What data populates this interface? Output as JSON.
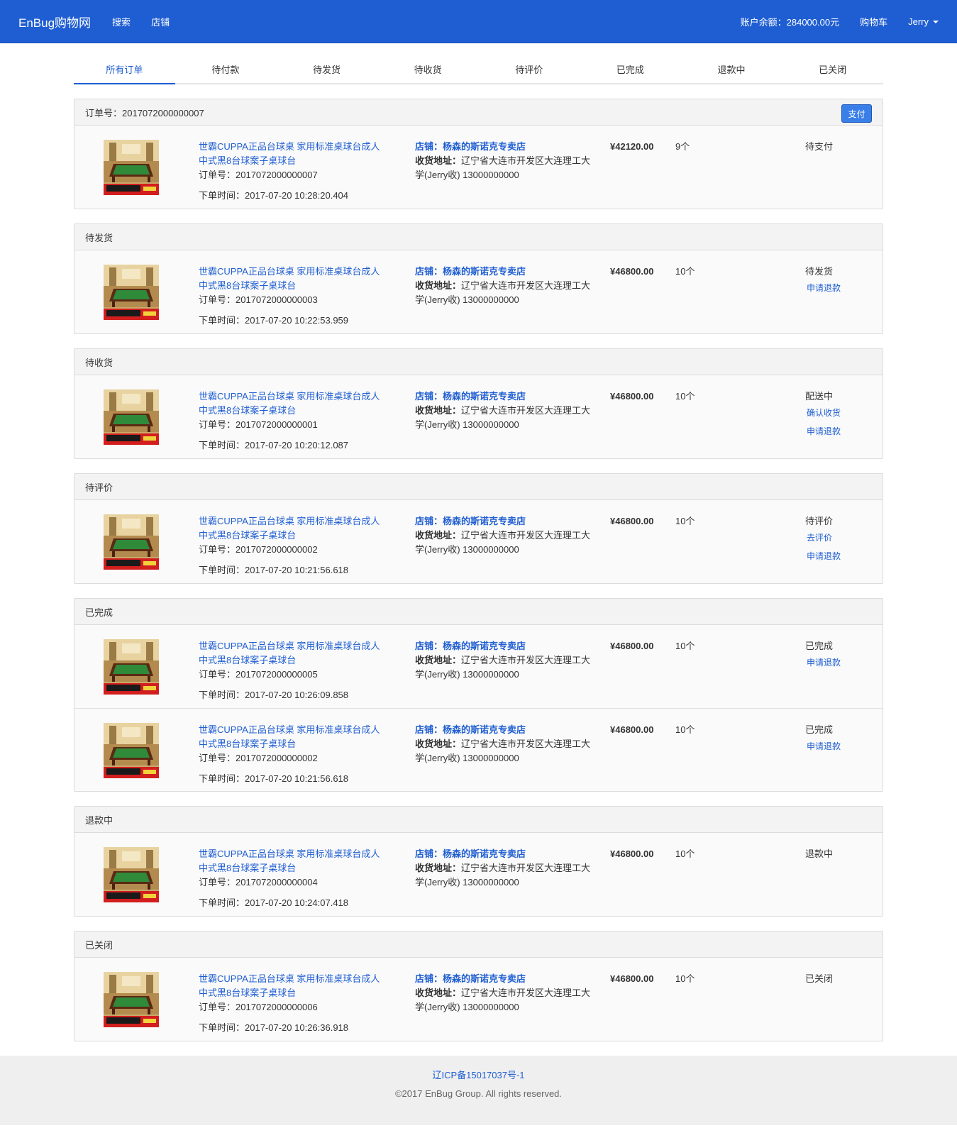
{
  "nav": {
    "brand": "EnBug购物网",
    "links": [
      "搜索",
      "店铺"
    ],
    "balance": "账户余额：284000.00元",
    "cart": "购物车",
    "user": "Jerry"
  },
  "tabs": [
    "所有订单",
    "待付款",
    "待发货",
    "待收货",
    "待评价",
    "已完成",
    "退款中",
    "已关闭"
  ],
  "pay_label": "支付",
  "panels": [
    {
      "header": "订单号：2017072000000007",
      "rows": [
        {
          "title1": "世霸CUPPA正品台球桌 家用标准桌球台成人",
          "title2": "中式黑8台球案子桌球台",
          "order_no": "订单号：2017072000000007",
          "time": "下单时间：2017-07-20 10:28:20.404",
          "shop": "店铺：杨森的斯诺克专卖店",
          "addr_label": "收货地址：",
          "addr1": "辽宁省大连市开发区大连理工大",
          "addr2": "学(Jerry收) 13000000000",
          "price": "¥42120.00",
          "qty": "9个",
          "status": "待支付",
          "actions": []
        }
      ]
    },
    {
      "header": "待发货",
      "rows": [
        {
          "title1": "世霸CUPPA正品台球桌 家用标准桌球台成人",
          "title2": "中式黑8台球案子桌球台",
          "order_no": "订单号：2017072000000003",
          "time": "下单时间：2017-07-20 10:22:53.959",
          "shop": "店铺：杨森的斯诺克专卖店",
          "addr_label": "收货地址：",
          "addr1": "辽宁省大连市开发区大连理工大",
          "addr2": "学(Jerry收) 13000000000",
          "price": "¥46800.00",
          "qty": "10个",
          "status": "待发货",
          "actions": [
            "申请退款"
          ]
        }
      ]
    },
    {
      "header": "待收货",
      "rows": [
        {
          "title1": "世霸CUPPA正品台球桌 家用标准桌球台成人",
          "title2": "中式黑8台球案子桌球台",
          "order_no": "订单号：2017072000000001",
          "time": "下单时间：2017-07-20 10:20:12.087",
          "shop": "店铺：杨森的斯诺克专卖店",
          "addr_label": "收货地址：",
          "addr1": "辽宁省大连市开发区大连理工大",
          "addr2": "学(Jerry收) 13000000000",
          "price": "¥46800.00",
          "qty": "10个",
          "status": "配送中",
          "actions": [
            "确认收货",
            "申请退款"
          ]
        }
      ]
    },
    {
      "header": "待评价",
      "rows": [
        {
          "title1": "世霸CUPPA正品台球桌 家用标准桌球台成人",
          "title2": "中式黑8台球案子桌球台",
          "order_no": "订单号：2017072000000002",
          "time": "下单时间：2017-07-20 10:21:56.618",
          "shop": "店铺：杨森的斯诺克专卖店",
          "addr_label": "收货地址：",
          "addr1": "辽宁省大连市开发区大连理工大",
          "addr2": "学(Jerry收) 13000000000",
          "price": "¥46800.00",
          "qty": "10个",
          "status": "待评价",
          "actions": [
            "去评价",
            "申请退款"
          ]
        }
      ]
    },
    {
      "header": "已完成",
      "rows": [
        {
          "title1": "世霸CUPPA正品台球桌 家用标准桌球台成人",
          "title2": "中式黑8台球案子桌球台",
          "order_no": "订单号：2017072000000005",
          "time": "下单时间：2017-07-20 10:26:09.858",
          "shop": "店铺：杨森的斯诺克专卖店",
          "addr_label": "收货地址：",
          "addr1": "辽宁省大连市开发区大连理工大",
          "addr2": "学(Jerry收) 13000000000",
          "price": "¥46800.00",
          "qty": "10个",
          "status": "已完成",
          "actions": [
            "申请退款"
          ]
        },
        {
          "title1": "世霸CUPPA正品台球桌 家用标准桌球台成人",
          "title2": "中式黑8台球案子桌球台",
          "order_no": "订单号：2017072000000002",
          "time": "下单时间：2017-07-20 10:21:56.618",
          "shop": "店铺：杨森的斯诺克专卖店",
          "addr_label": "收货地址：",
          "addr1": "辽宁省大连市开发区大连理工大",
          "addr2": "学(Jerry收) 13000000000",
          "price": "¥46800.00",
          "qty": "10个",
          "status": "已完成",
          "actions": [
            "申请退款"
          ]
        }
      ]
    },
    {
      "header": "退款中",
      "rows": [
        {
          "title1": "世霸CUPPA正品台球桌 家用标准桌球台成人",
          "title2": "中式黑8台球案子桌球台",
          "order_no": "订单号：2017072000000004",
          "time": "下单时间：2017-07-20 10:24:07.418",
          "shop": "店铺：杨森的斯诺克专卖店",
          "addr_label": "收货地址：",
          "addr1": "辽宁省大连市开发区大连理工大",
          "addr2": "学(Jerry收) 13000000000",
          "price": "¥46800.00",
          "qty": "10个",
          "status": "退款中",
          "actions": []
        }
      ]
    },
    {
      "header": "已关闭",
      "rows": [
        {
          "title1": "世霸CUPPA正品台球桌 家用标准桌球台成人",
          "title2": "中式黑8台球案子桌球台",
          "order_no": "订单号：2017072000000006",
          "time": "下单时间：2017-07-20 10:26:36.918",
          "shop": "店铺：杨森的斯诺克专卖店",
          "addr_label": "收货地址：",
          "addr1": "辽宁省大连市开发区大连理工大",
          "addr2": "学(Jerry收) 13000000000",
          "price": "¥46800.00",
          "qty": "10个",
          "status": "已关闭",
          "actions": []
        }
      ]
    }
  ],
  "footer": {
    "icp": "辽ICP备15017037号-1",
    "copyright": "©2017 EnBug Group. All rights reserved."
  },
  "colors": {
    "primary": "#1f5ed2",
    "button": "#3a7fe8"
  }
}
